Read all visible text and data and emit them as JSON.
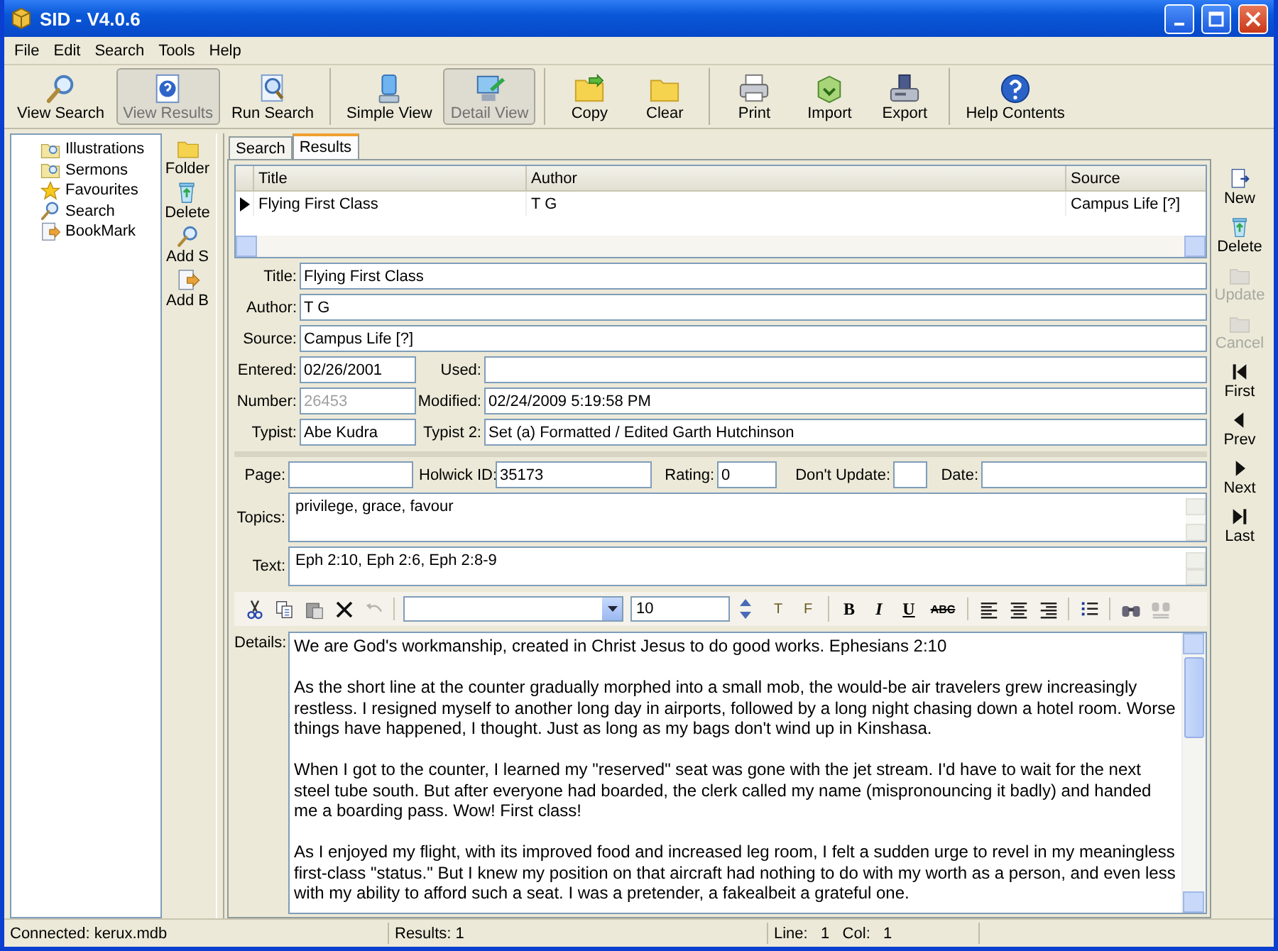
{
  "window": {
    "title": "SID - V4.0.6"
  },
  "menu": [
    "File",
    "Edit",
    "Search",
    "Tools",
    "Help"
  ],
  "toolbar": [
    [
      {
        "label": "View Search",
        "kind": "search",
        "selected": false
      },
      {
        "label": "View Results",
        "kind": "helpdoc",
        "selected": true
      },
      {
        "label": "Run Search",
        "kind": "docsearch",
        "selected": false
      }
    ],
    [
      {
        "label": "Simple View",
        "kind": "monitor",
        "selected": false
      },
      {
        "label": "Detail View",
        "kind": "monitorpen",
        "selected": true
      }
    ],
    [
      {
        "label": "Copy",
        "kind": "foldercopy",
        "selected": false
      },
      {
        "label": "Clear",
        "kind": "folder",
        "selected": false
      }
    ],
    [
      {
        "label": "Print",
        "kind": "printer",
        "selected": false
      },
      {
        "label": "Import",
        "kind": "box",
        "selected": false
      },
      {
        "label": "Export",
        "kind": "drive",
        "selected": false
      }
    ],
    [
      {
        "label": "Help Contents",
        "kind": "help",
        "selected": false
      }
    ]
  ],
  "tree": [
    {
      "label": "Illustrations",
      "kind": "foldersearch"
    },
    {
      "label": "Sermons",
      "kind": "foldersearch"
    },
    {
      "label": "Favourites",
      "kind": "star"
    },
    {
      "label": "Search",
      "kind": "search"
    },
    {
      "label": "BookMark",
      "kind": "bookmark"
    }
  ],
  "side_tools": [
    {
      "label": "Folder",
      "kind": "folder"
    },
    {
      "label": "Delete",
      "kind": "recycle"
    },
    {
      "label": "Add S",
      "kind": "search"
    },
    {
      "label": "Add B",
      "kind": "bookmark"
    }
  ],
  "tabs": [
    {
      "label": "Search",
      "selected": false
    },
    {
      "label": "Results",
      "selected": true
    }
  ],
  "grid": {
    "columns": [
      "Title",
      "Author",
      "Source"
    ],
    "rows": [
      {
        "cells": [
          "Flying First Class",
          "T G",
          "Campus Life [?]"
        ],
        "selected": true
      }
    ]
  },
  "record": [
    [
      {
        "label": "Title:",
        "value": "Flying First Class"
      }
    ],
    [
      {
        "label": "Author:",
        "value": "T G"
      }
    ],
    [
      {
        "label": "Source:",
        "value": "Campus Life [?]"
      }
    ],
    [
      {
        "label": "Entered:",
        "value": "02/26/2001"
      },
      {
        "label": "Used:"
      }
    ],
    [
      {
        "label": "Number:",
        "value": "26453",
        "disabled": true
      },
      {
        "label": "Modified:",
        "value": "02/24/2009 5:19:58 PM"
      }
    ],
    [
      {
        "label": "Typist:",
        "value": "Abe Kudra"
      },
      {
        "label": "Typist 2:",
        "value": "Set (a) Formatted / Edited Garth Hutchinson"
      }
    ]
  ],
  "extra": [
    {
      "label": "Page:",
      "kind": "page"
    },
    {
      "label": "Holwick ID:",
      "value": "35173",
      "kind": "id"
    },
    {
      "label": "Rating:",
      "value": "0",
      "kind": "rating"
    },
    {
      "label": "Don't Update:",
      "kind": "check",
      "checked": false
    },
    {
      "label": "Date:",
      "kind": "date"
    }
  ],
  "topics": {
    "label": "Topics:",
    "value": "privilege, grace, favour"
  },
  "text": {
    "label": "Text:",
    "value": "Eph 2:10, Eph 2:6, Eph 2:8-9"
  },
  "editor_toolbar": [
    [
      {
        "kind": "cut",
        "disabled": false
      },
      {
        "kind": "copy",
        "disabled": false
      },
      {
        "kind": "paste",
        "disabled": false
      },
      {
        "kind": "delete",
        "disabled": false
      },
      {
        "kind": "undo",
        "disabled": true
      }
    ],
    [
      {
        "kind": "font"
      },
      {
        "kind": "size",
        "value": "10"
      },
      {
        "kind": "text",
        "label": "T"
      },
      {
        "kind": "text",
        "label": "F"
      }
    ],
    [
      {
        "kind": "bold",
        "label": "B",
        "disabled": false
      },
      {
        "kind": "italic",
        "label": "I",
        "disabled": false
      },
      {
        "kind": "underline",
        "label": "U",
        "disabled": false
      },
      {
        "kind": "strike",
        "label": "ABC",
        "disabled": false
      }
    ],
    [
      {
        "kind": "alignleft",
        "disabled": false
      },
      {
        "kind": "aligncenter",
        "disabled": false
      },
      {
        "kind": "alignright",
        "disabled": false
      }
    ],
    [
      {
        "kind": "list",
        "disabled": false
      }
    ],
    [
      {
        "kind": "find",
        "disabled": false
      },
      {
        "kind": "replace",
        "disabled": true
      }
    ]
  ],
  "details": {
    "label": "Details:",
    "paragraphs": [
      "We are God's workmanship, created in Christ Jesus to do good works. Ephesians 2:10",
      "As the short line at the counter gradually morphed into a small mob, the would-be air travelers grew increasingly restless. I resigned myself to another long day in airports, followed by a long night chasing down a hotel room. Worse things have happened, I thought. Just as long as my bags don't wind up in Kinshasa.",
      "When I got to the counter, I learned my \"reserved\" seat was gone with the jet stream. I'd have to wait for the next steel tube south. But after everyone had boarded, the clerk called my name (mispronouncing it badly) and handed me a boarding pass. Wow! First class!",
      "As I enjoyed my flight, with its improved food and increased leg room, I felt a sudden urge to revel in my meaningless first-class \"status.\" But I knew my position on that aircraft had nothing to do with my worth as a person, and even less with my ability to afford such a seat. I was a pretender, a fakealbeit a grateful one."
    ]
  },
  "nav": [
    {
      "label": "New",
      "kind": "new",
      "disabled": false
    },
    {
      "label": "Delete",
      "kind": "recycle",
      "disabled": false
    },
    {
      "label": "Update",
      "kind": "folder",
      "disabled": true
    },
    {
      "label": "Cancel",
      "kind": "folder",
      "disabled": true
    },
    {
      "label": "First",
      "kind": "first",
      "disabled": false
    },
    {
      "label": "Prev",
      "kind": "prev",
      "disabled": false
    },
    {
      "label": "Next",
      "kind": "next",
      "disabled": false
    },
    {
      "label": "Last",
      "kind": "last",
      "disabled": false
    }
  ],
  "status_bar": [
    "Connected: kerux.mdb",
    "Results: 1",
    "Line:   1   Col:   1"
  ]
}
